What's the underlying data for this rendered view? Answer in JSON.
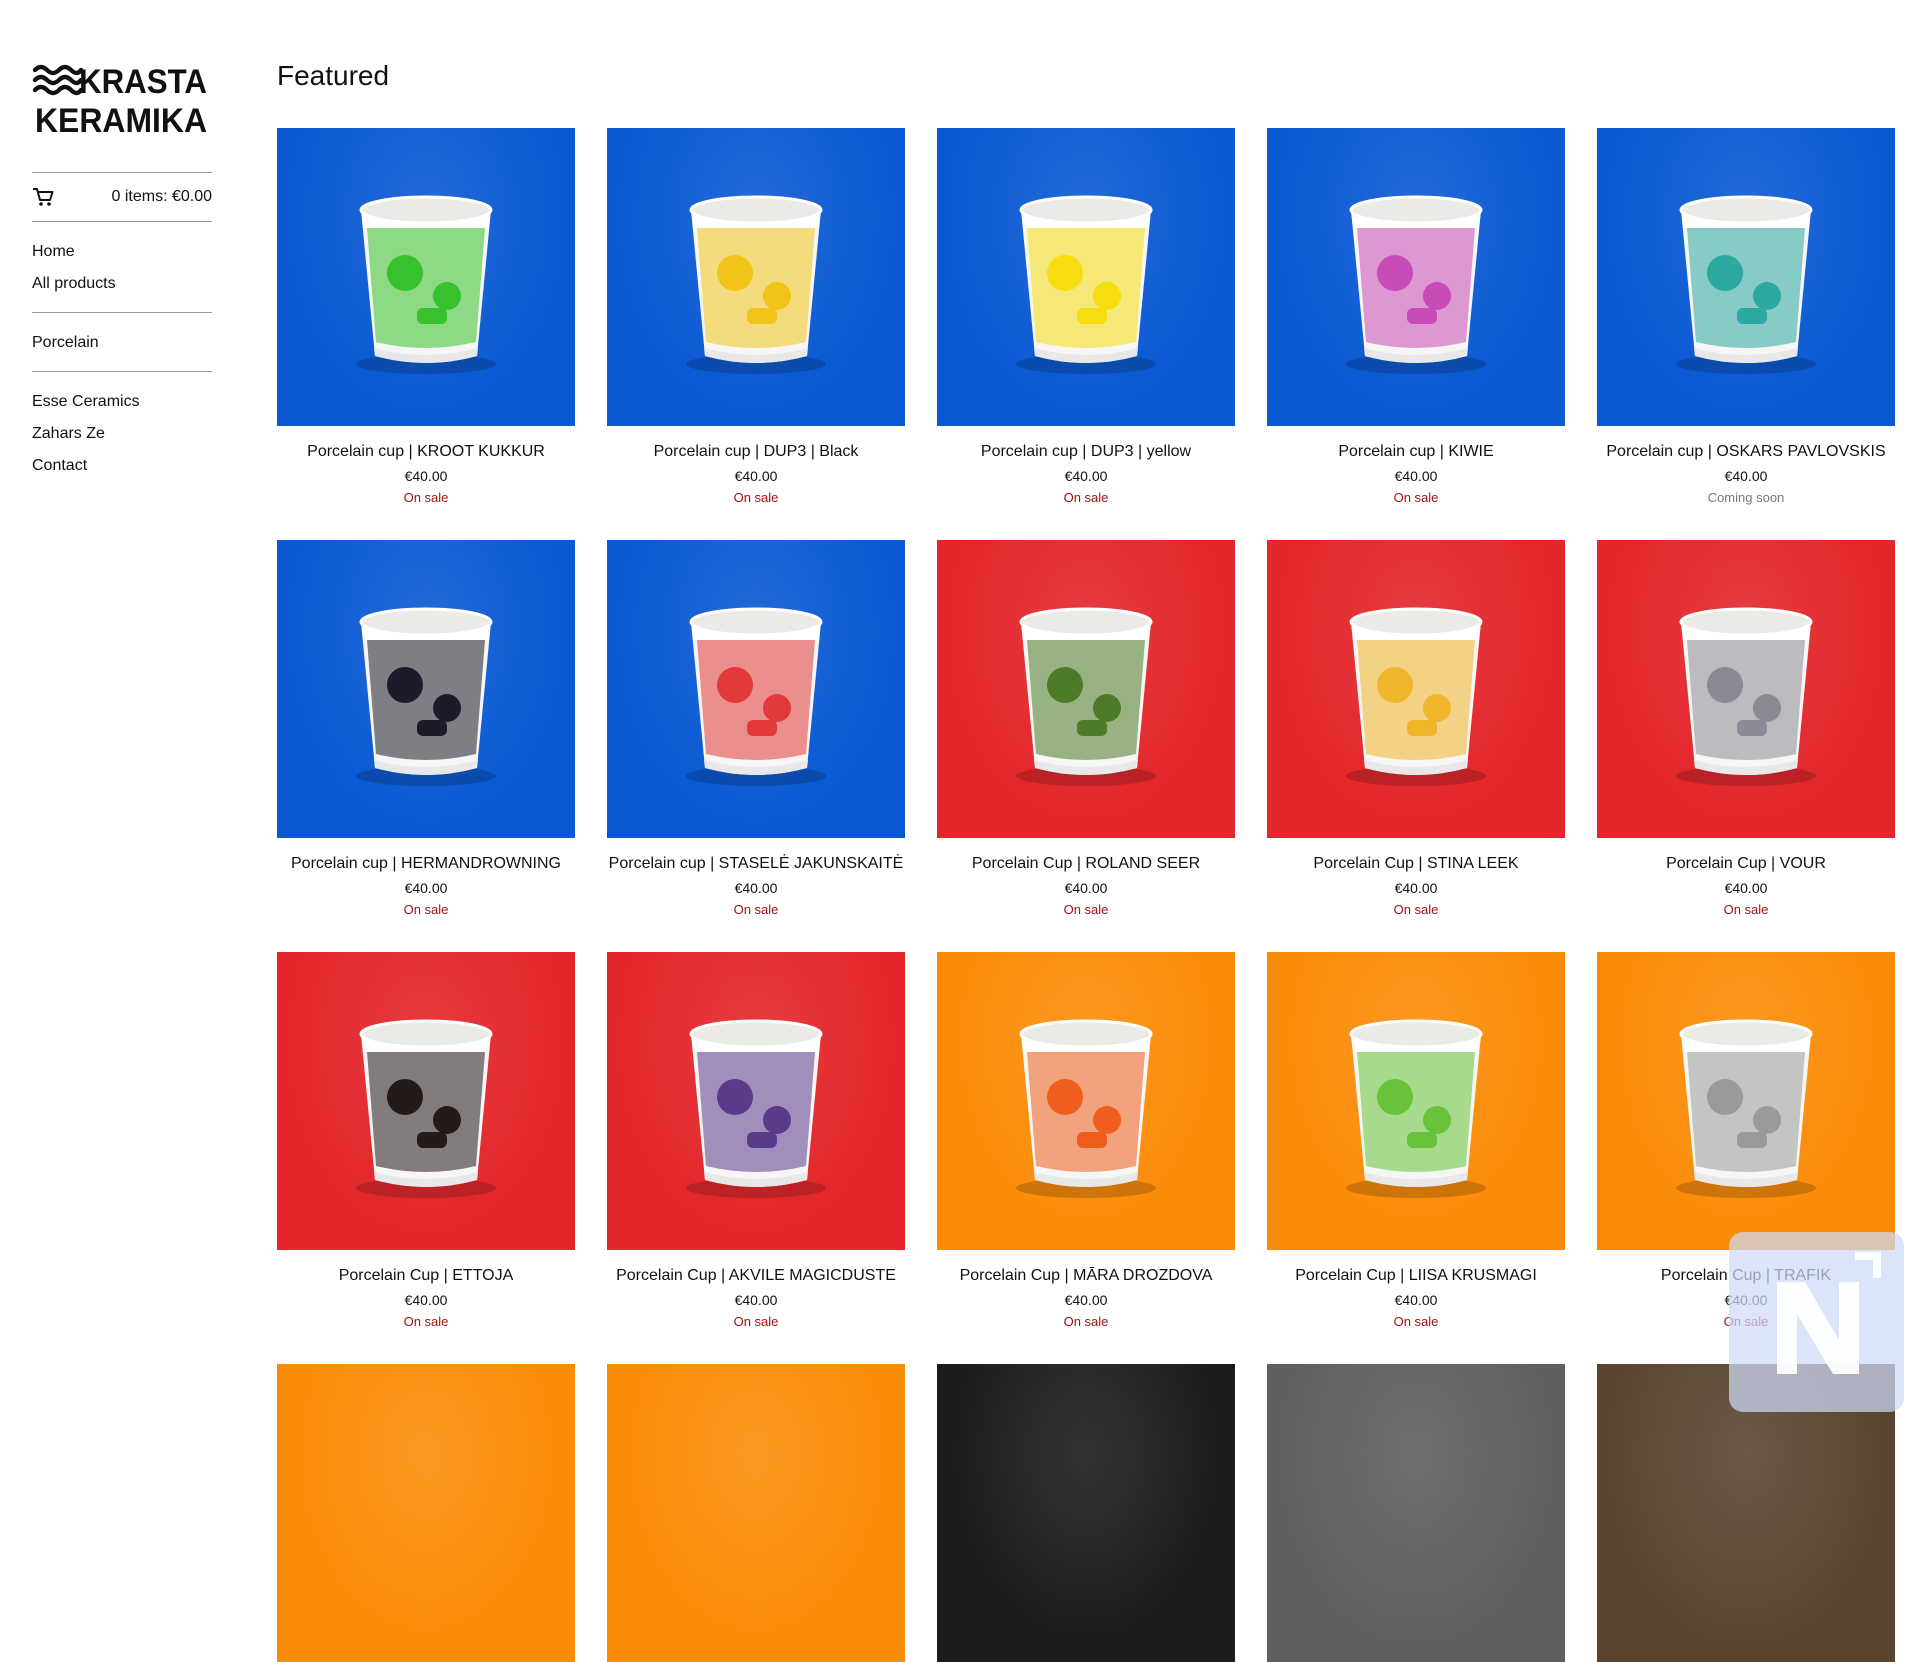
{
  "brand": {
    "name_line1": "KRASTA",
    "name_line2": "KERAMIKA"
  },
  "cart": {
    "summary": "0 items: €0.00",
    "icon": "cart-icon"
  },
  "nav": {
    "main": [
      {
        "label": "Home"
      },
      {
        "label": "All products"
      }
    ],
    "categories": [
      {
        "label": "Porcelain"
      }
    ],
    "pages": [
      {
        "label": "Esse Ceramics"
      },
      {
        "label": "Zahars Ze"
      },
      {
        "label": "Contact"
      }
    ]
  },
  "page": {
    "title": "Featured"
  },
  "products": [
    {
      "title": "Porcelain cup | KROOT KUKKUR",
      "price": "€40.00",
      "status": "On sale",
      "bg": "#0a59d3",
      "print": "#37c12c"
    },
    {
      "title": "Porcelain cup | DUP3 | Black",
      "price": "€40.00",
      "status": "On sale",
      "bg": "#0a59d3",
      "print": "#f2c419"
    },
    {
      "title": "Porcelain cup | DUP3 | yellow",
      "price": "€40.00",
      "status": "On sale",
      "bg": "#0a59d3",
      "print": "#f5dd10"
    },
    {
      "title": "Porcelain cup | KIWIE",
      "price": "€40.00",
      "status": "On sale",
      "bg": "#0a59d3",
      "print": "#c94bb8"
    },
    {
      "title": "Porcelain cup | OSKARS PAVLOVSKIS",
      "price": "€40.00",
      "status": "Coming soon",
      "bg": "#0a59d3",
      "print": "#2ba8a0"
    },
    {
      "title": "Porcelain cup | HERMANDROWNING",
      "price": "€40.00",
      "status": "On sale",
      "bg": "#0a59d3",
      "print": "#1b1b2a"
    },
    {
      "title": "Porcelain cup | STASELĖ JAKUNSKAITĖ",
      "price": "€40.00",
      "status": "On sale",
      "bg": "#0a59d3",
      "print": "#e23a3a"
    },
    {
      "title": "Porcelain Cup | ROLAND SEER",
      "price": "€40.00",
      "status": "On sale",
      "bg": "#e3262b",
      "print": "#4c7a26"
    },
    {
      "title": "Porcelain Cup | STINA LEEK",
      "price": "€40.00",
      "status": "On sale",
      "bg": "#e3262b",
      "print": "#f0b52a"
    },
    {
      "title": "Porcelain Cup | VOUR",
      "price": "€40.00",
      "status": "On sale",
      "bg": "#e3262b",
      "print": "#8a8a95"
    },
    {
      "title": "Porcelain Cup | ETTOJA",
      "price": "€40.00",
      "status": "On sale",
      "bg": "#e3262b",
      "print": "#231a1a"
    },
    {
      "title": "Porcelain Cup | AKVILE MAGICDUSTE",
      "price": "€40.00",
      "status": "On sale",
      "bg": "#e3262b",
      "print": "#5a3a8a"
    },
    {
      "title": "Porcelain Cup | MĀRA DROZDOVA",
      "price": "€40.00",
      "status": "On sale",
      "bg": "#fb8c08",
      "print": "#ef5e1d"
    },
    {
      "title": "Porcelain Cup | LIISA KRUSMAGI",
      "price": "€40.00",
      "status": "On sale",
      "bg": "#fb8c08",
      "print": "#68c23a"
    },
    {
      "title": "Porcelain Cup | TRAFIK",
      "price": "€40.00",
      "status": "On sale",
      "bg": "#fb8c08",
      "print": "#9a9a9a"
    },
    {
      "title": "",
      "price": "",
      "status": "",
      "bg": "#fb8c08",
      "print": ""
    },
    {
      "title": "",
      "price": "",
      "status": "",
      "bg": "#fb8c08",
      "print": ""
    },
    {
      "title": "",
      "price": "",
      "status": "",
      "bg": "#1c1c1c",
      "print": ""
    },
    {
      "title": "",
      "price": "",
      "status": "",
      "bg": "#5e5f61",
      "print": ""
    },
    {
      "title": "",
      "price": "",
      "status": "",
      "bg": "#5a4630",
      "print": ""
    }
  ],
  "colors": {
    "sale": "#a11212",
    "coming_soon": "#777777"
  }
}
